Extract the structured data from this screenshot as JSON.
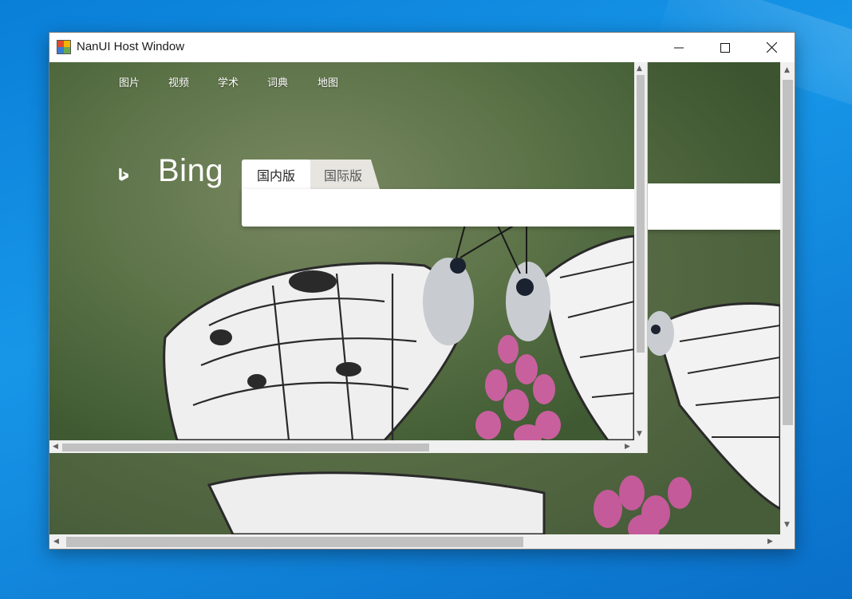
{
  "window": {
    "title": "NanUI Host Window"
  },
  "bing": {
    "nav": [
      "图片",
      "视频",
      "学术",
      "词典",
      "地图"
    ],
    "logo_text": "Bing",
    "tabs": {
      "domestic": "国内版",
      "international": "国际版"
    }
  },
  "colors": {
    "desktop": "#0a7fd8",
    "titlebar": "#ffffff",
    "scrollbar_track": "#f0f0f0",
    "scrollbar_thumb": "#c1c1c1"
  }
}
